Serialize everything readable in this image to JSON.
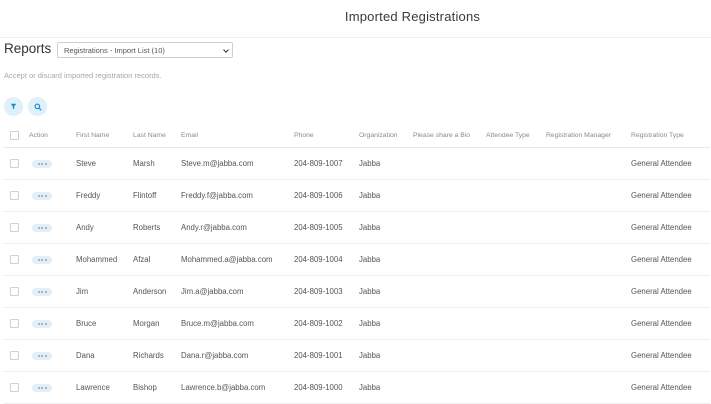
{
  "header": {
    "title": "Imported Registrations"
  },
  "reports": {
    "label": "Reports",
    "selected": "Registrations - Import List (10)",
    "subtitle": "Accept or discard imported registration records."
  },
  "toolbar": {
    "filter_icon": "filter-icon",
    "search_icon": "search-icon",
    "accent": "#dff0fa"
  },
  "table": {
    "columns": [
      "Action",
      "First Name",
      "Last Name",
      "Email",
      "Phone",
      "Organization",
      "Please share a Bio",
      "Attendee Type",
      "Registration Manager",
      "Registration Type"
    ],
    "rows": [
      {
        "first": "Steve",
        "last": "Marsh",
        "email": "Steve.m@jabba.com",
        "phone": "204-809-1007",
        "org": "Jabba",
        "bio": "",
        "attendee_type": "",
        "manager": "",
        "reg_type": "General Attendee"
      },
      {
        "first": "Freddy",
        "last": "Flintoff",
        "email": "Freddy.f@jabba.com",
        "phone": "204-809-1006",
        "org": "Jabba",
        "bio": "",
        "attendee_type": "",
        "manager": "",
        "reg_type": "General Attendee"
      },
      {
        "first": "Andy",
        "last": "Roberts",
        "email": "Andy.r@jabba.com",
        "phone": "204-809-1005",
        "org": "Jabba",
        "bio": "",
        "attendee_type": "",
        "manager": "",
        "reg_type": "General Attendee"
      },
      {
        "first": "Mohammed",
        "last": "Afzal",
        "email": "Mohammed.a@jabba.com",
        "phone": "204-809-1004",
        "org": "Jabba",
        "bio": "",
        "attendee_type": "",
        "manager": "",
        "reg_type": "General Attendee"
      },
      {
        "first": "Jim",
        "last": "Anderson",
        "email": "Jim.a@jabba.com",
        "phone": "204-809-1003",
        "org": "Jabba",
        "bio": "",
        "attendee_type": "",
        "manager": "",
        "reg_type": "General Attendee"
      },
      {
        "first": "Bruce",
        "last": "Morgan",
        "email": "Bruce.m@jabba.com",
        "phone": "204-809-1002",
        "org": "Jabba",
        "bio": "",
        "attendee_type": "",
        "manager": "",
        "reg_type": "General Attendee"
      },
      {
        "first": "Dana",
        "last": "Richards",
        "email": "Dana.r@jabba.com",
        "phone": "204-809-1001",
        "org": "Jabba",
        "bio": "",
        "attendee_type": "",
        "manager": "",
        "reg_type": "General Attendee"
      },
      {
        "first": "Lawrence",
        "last": "Bishop",
        "email": "Lawrence.b@jabba.com",
        "phone": "204-809-1000",
        "org": "Jabba",
        "bio": "",
        "attendee_type": "",
        "manager": "",
        "reg_type": "General Attendee"
      }
    ]
  }
}
